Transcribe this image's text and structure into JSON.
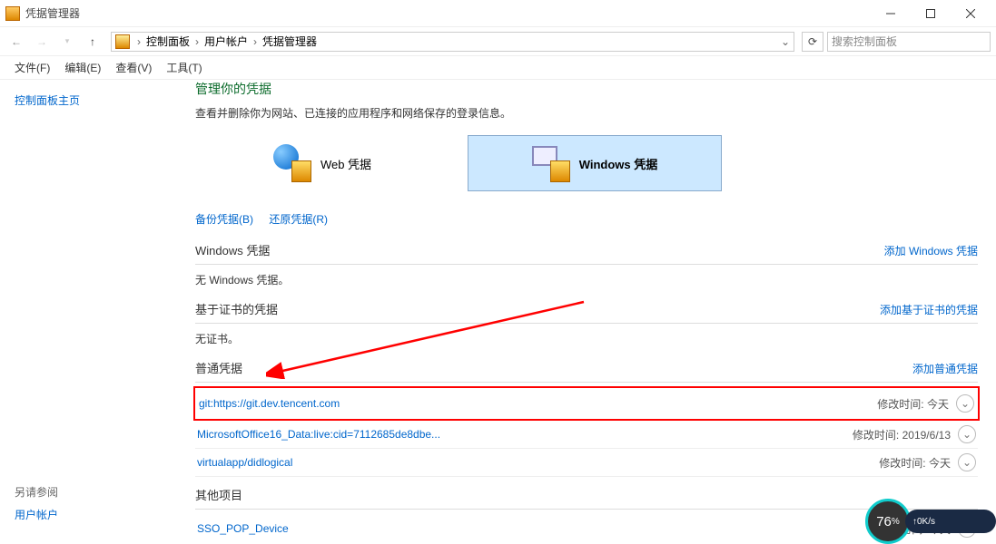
{
  "window": {
    "title": "凭据管理器"
  },
  "breadcrumb": {
    "items": [
      "控制面板",
      "用户帐户",
      "凭据管理器"
    ]
  },
  "search": {
    "placeholder": "搜索控制面板"
  },
  "menu": {
    "file": "文件(F)",
    "edit": "编辑(E)",
    "view": "查看(V)",
    "tools": "工具(T)"
  },
  "sidebar": {
    "home": "控制面板主页",
    "seealso": "另请参阅",
    "useraccounts": "用户帐户"
  },
  "page": {
    "title": "管理你的凭据",
    "subtitle": "查看并删除你为网站、已连接的应用程序和网络保存的登录信息。"
  },
  "tiles": {
    "web": "Web 凭据",
    "windows": "Windows 凭据"
  },
  "links": {
    "backup": "备份凭据(B)",
    "restore": "还原凭据(R)"
  },
  "sections": {
    "windows": {
      "title": "Windows 凭据",
      "add": "添加 Windows 凭据",
      "empty": "无 Windows 凭据。"
    },
    "cert": {
      "title": "基于证书的凭据",
      "add": "添加基于证书的凭据",
      "empty": "无证书。"
    },
    "generic": {
      "title": "普通凭据",
      "add": "添加普通凭据"
    },
    "other": {
      "title": "其他项目"
    }
  },
  "meta_label": "修改时间:",
  "creds": {
    "generic": [
      {
        "name": "git:https://git.dev.tencent.com",
        "modified": "今天",
        "highlighted": true
      },
      {
        "name": "MicrosoftOffice16_Data:live:cid=7112685de8dbe...",
        "modified": "2019/6/13"
      },
      {
        "name": "virtualapp/didlogical",
        "modified": "今天"
      }
    ],
    "other": [
      {
        "name": "SSO_POP_Device",
        "modified": "今天"
      }
    ]
  },
  "perf": {
    "pct": "76",
    "net": "0K/s"
  }
}
